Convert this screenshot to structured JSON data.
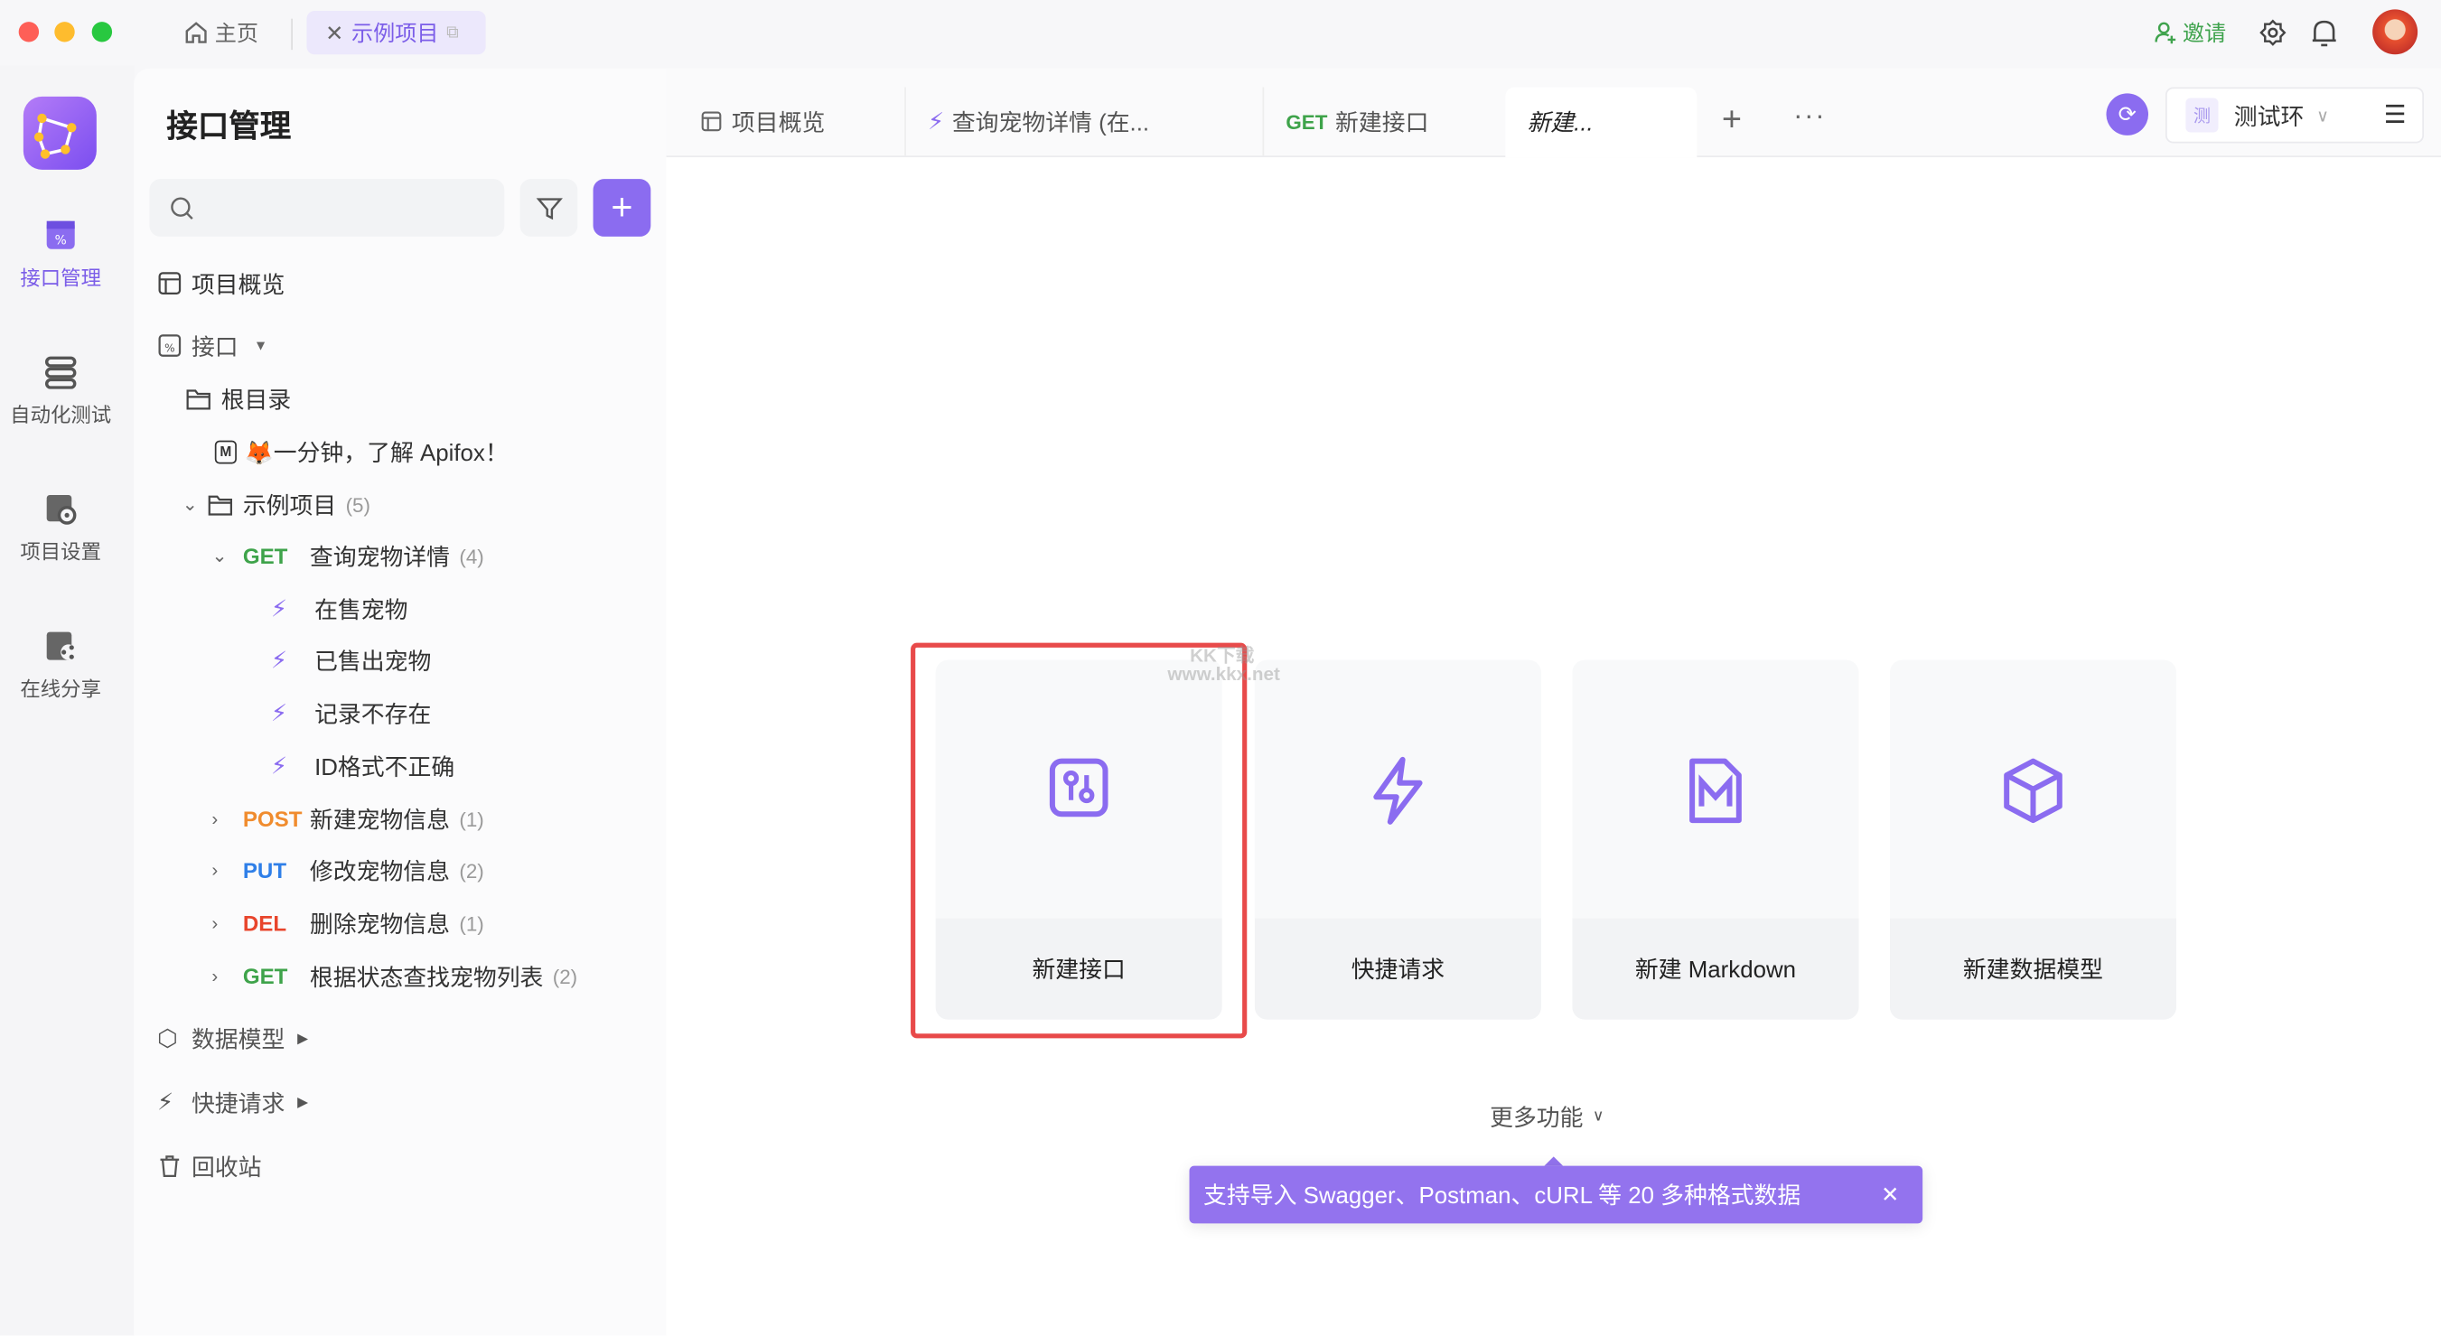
{
  "titlebar": {
    "home_label": "主页",
    "project_tab": "示例项目",
    "invite": "邀请"
  },
  "rail": {
    "items": [
      {
        "label": "接口管理",
        "active": true
      },
      {
        "label": "自动化测试"
      },
      {
        "label": "项目设置"
      },
      {
        "label": "在线分享"
      }
    ]
  },
  "sidebar": {
    "title": "接口管理",
    "search_placeholder": "",
    "overview": "项目概览",
    "interfaces": "接口",
    "root": "根目录",
    "doc": "🦊一分钟，了解 Apifox！",
    "folder": {
      "label": "示例项目",
      "count": "(5)"
    },
    "endpoints": [
      {
        "method": "GET",
        "label": "查询宠物详情",
        "count": "(4)",
        "color": "#3ea34a",
        "expanded": true,
        "cases": [
          "在售宠物",
          "已售出宠物",
          "记录不存在",
          "ID格式不正确"
        ]
      },
      {
        "method": "POST",
        "label": "新建宠物信息",
        "count": "(1)",
        "color": "#f08c2e"
      },
      {
        "method": "PUT",
        "label": "修改宠物信息",
        "count": "(2)",
        "color": "#2f7fe8"
      },
      {
        "method": "DEL",
        "label": "删除宠物信息",
        "count": "(1)",
        "color": "#e8452c"
      },
      {
        "method": "GET",
        "label": "根据状态查找宠物列表",
        "count": "(2)",
        "color": "#3ea34a"
      }
    ],
    "data_models": "数据模型",
    "quick_requests": "快捷请求",
    "trash": "回收站"
  },
  "tabs": [
    {
      "label": "项目概览",
      "icon": "layout-icon"
    },
    {
      "label": "查询宠物详情 (在...",
      "icon": "case-icon"
    },
    {
      "method": "GET",
      "label": "新建接口"
    },
    {
      "label": "新建...",
      "active": true
    }
  ],
  "env": {
    "badge": "测",
    "label": "测试环"
  },
  "cards": [
    {
      "label": "新建接口",
      "icon": "api-icon",
      "highlighted": true
    },
    {
      "label": "快捷请求",
      "icon": "lightning-icon"
    },
    {
      "label": "新建 Markdown",
      "icon": "markdown-icon"
    },
    {
      "label": "新建数据模型",
      "icon": "cube-icon"
    }
  ],
  "more": "更多功能",
  "tooltip": "支持导入 Swagger、Postman、cURL 等 20 多种格式数据",
  "watermark": "KK下载 www.kkx.net",
  "colors": {
    "accent": "#8b6cf0",
    "highlight": "#e84a4a",
    "tooltip_bg": "#9373ee"
  }
}
